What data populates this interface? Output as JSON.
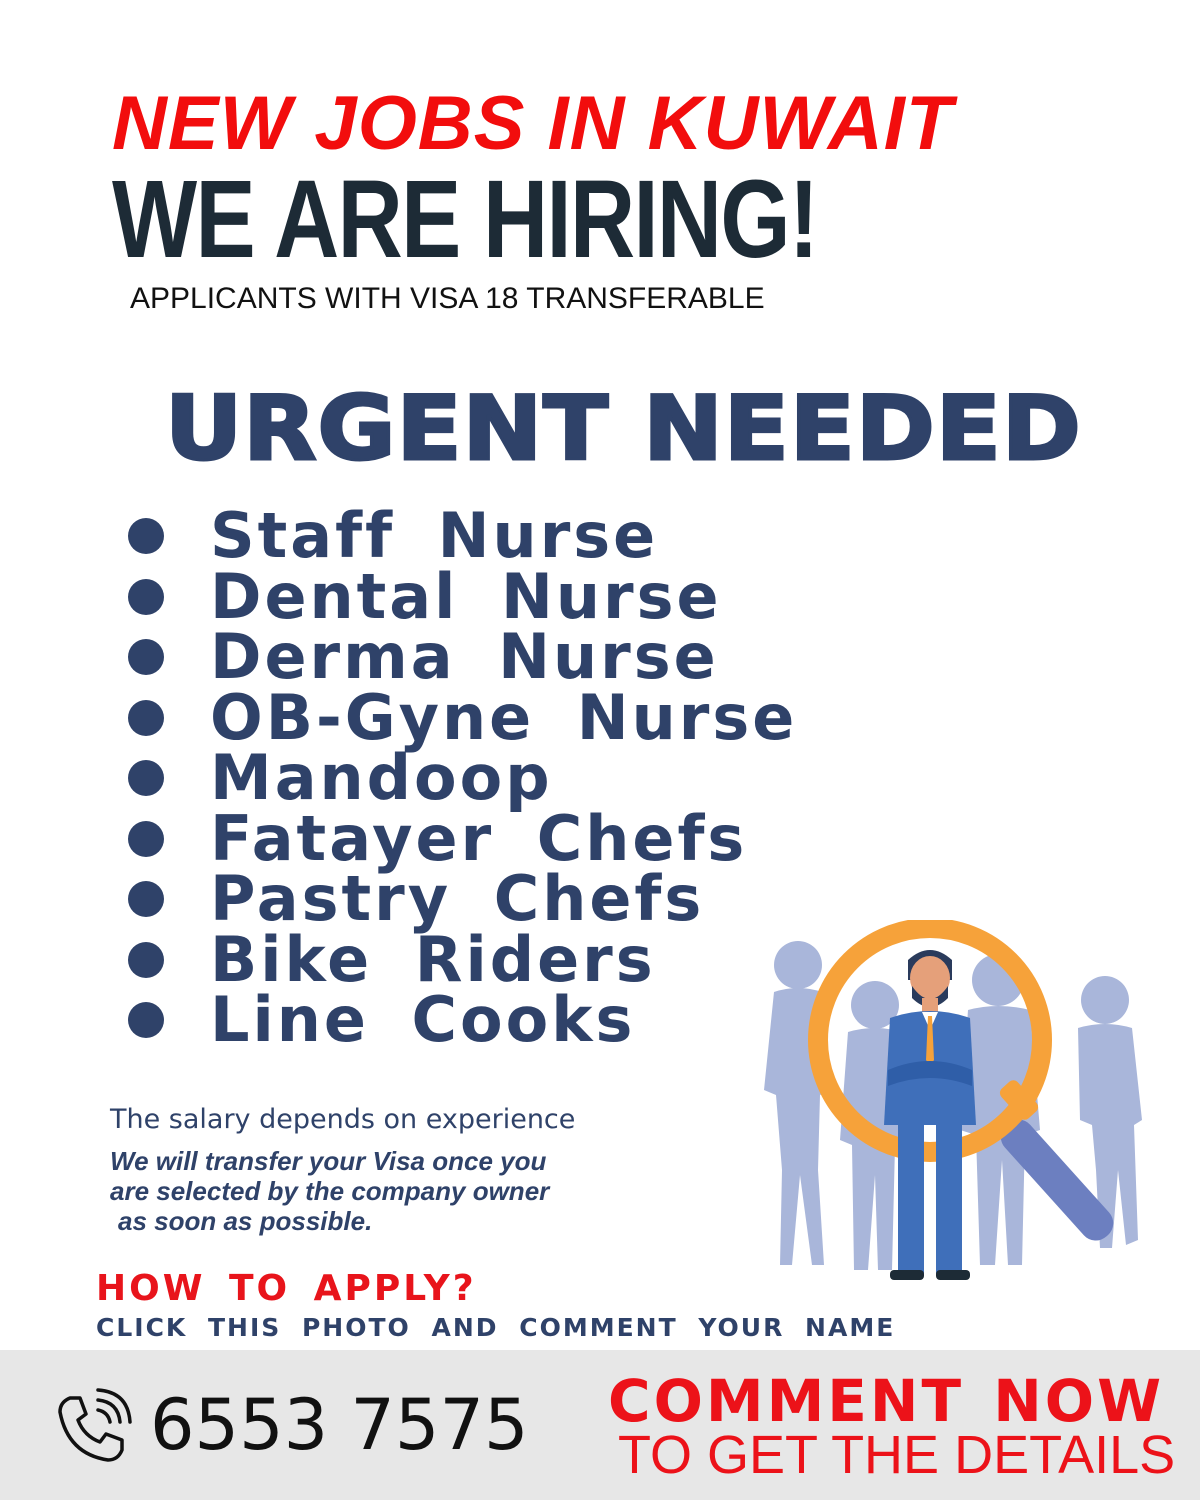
{
  "header": {
    "headline": "NEW JOBS IN KUWAIT",
    "hiring": "WE ARE HIRING!",
    "subline": "APPLICANTS WITH VISA 18 TRANSFERABLE"
  },
  "urgent_title": "URGENT NEEDED",
  "jobs": [
    "Staff Nurse",
    "Dental Nurse",
    "Derma Nurse",
    "OB-Gyne Nurse",
    "Mandoop",
    "Fatayer Chefs",
    "Pastry Chefs",
    "Bike Riders",
    "Line Cooks"
  ],
  "info": {
    "salary": "The salary depends on experience",
    "transfer_lines": [
      "We will transfer your Visa once you",
      "are selected by the company owner",
      "as soon as possible."
    ]
  },
  "apply": {
    "title": "HOW TO APPLY?",
    "instruction": "CLICK THIS PHOTO AND COMMENT YOUR NAME"
  },
  "footer": {
    "phone_icon": "phone-icon",
    "phone": "6553 7575",
    "cta": "COMMENT NOW",
    "cta_sub": "TO GET THE DETAILS"
  },
  "colors": {
    "red": "#f20d0d",
    "navy": "#2f4269",
    "dark": "#1d2b36",
    "footer_bg": "#e7e7e7",
    "magnifier_ring": "#f6a23a",
    "silhouette": "#a9b6da"
  }
}
